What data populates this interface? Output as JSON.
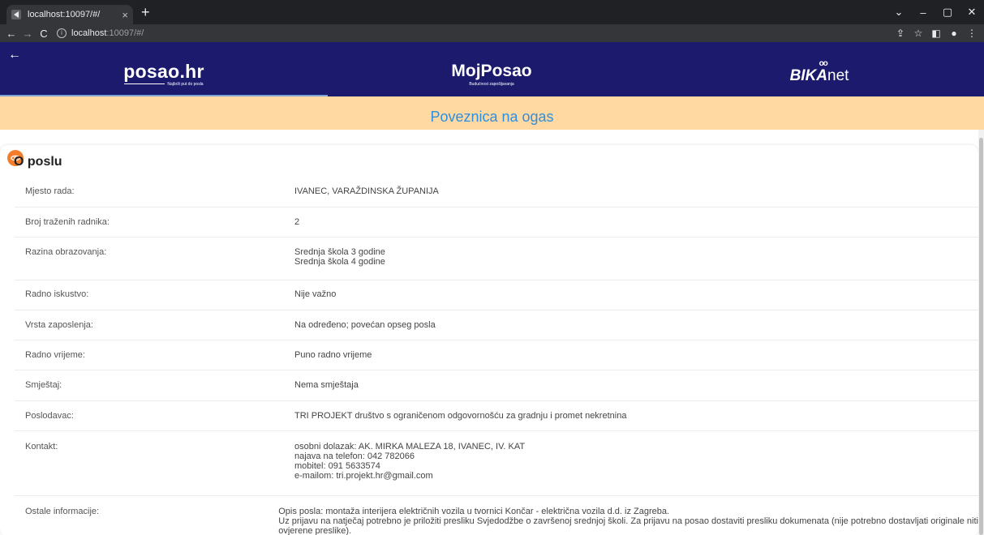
{
  "browser": {
    "tab_title": "localhost:10097/#/",
    "tab_close": "×",
    "new_tab": "+",
    "url_host": "localhost",
    "url_path": ":10097/#/",
    "back": "←",
    "forward": "→",
    "reload": "C",
    "win_min": "–",
    "win_max": "▢",
    "win_close": "✕",
    "tab_search": "⌄"
  },
  "header": {
    "back_arrow": "←",
    "portals": [
      {
        "name": "posao.hr",
        "tagline": "Najbrži put do posla"
      },
      {
        "name": "MojPosao",
        "tagline": "Budućnost zapošljavanja"
      },
      {
        "name_bold": "BIKA",
        "name_light": "net",
        "dots": "oo"
      }
    ]
  },
  "banner": {
    "link_text": "Poveznica na ogas"
  },
  "section": {
    "title": "O poslu"
  },
  "details": [
    {
      "label": "Mjesto rada:",
      "values": [
        "IVANEC, VARAŽDINSKA ŽUPANIJA"
      ]
    },
    {
      "label": "Broj traženih radnika:",
      "values": [
        "2"
      ]
    },
    {
      "label": "Razina obrazovanja:",
      "values": [
        "Srednja škola 3 godine",
        "Srednja škola 4 godine"
      ]
    },
    {
      "label": "Radno iskustvo:",
      "values": [
        "Nije važno"
      ]
    },
    {
      "label": "Vrsta zaposlenja:",
      "values": [
        "Na određeno; povećan opseg posla"
      ]
    },
    {
      "label": "Radno vrijeme:",
      "values": [
        "Puno radno vrijeme"
      ]
    },
    {
      "label": "Smještaj:",
      "values": [
        "Nema smještaja"
      ]
    },
    {
      "label": "Poslodavac:",
      "values": [
        "TRI PROJEKT društvo s ograničenom odgovornošću za gradnju i promet nekretnina"
      ]
    },
    {
      "label": "Kontakt:",
      "values": [
        "osobni dolazak: AK. MIRKA MALEZA 18, IVANEC, IV. KAT",
        "najava na telefon: 042 782066",
        "mobitel: 091 5633574",
        "e-mailom: tri.projekt.hr@gmail.com"
      ]
    },
    {
      "label": "Ostale informacije:",
      "values": [
        "Opis posla: montaža interijera električnih vozila u tvornici Končar - električna vozila d.d. iz Zagreba.",
        "Uz prijavu na natječaj potrebno je priložiti presliku Svjedodžbe o završenoj srednjoj školi. Za prijavu na posao dostaviti presliku dokumenata (nije potrebno dostavljati originale niti",
        "ovjerene preslike)."
      ]
    }
  ],
  "colors": {
    "header_bg": "#1b1a6c",
    "banner_bg": "#ffd9a1",
    "banner_text": "#2d8fe0",
    "badge": "#f47d2c"
  }
}
